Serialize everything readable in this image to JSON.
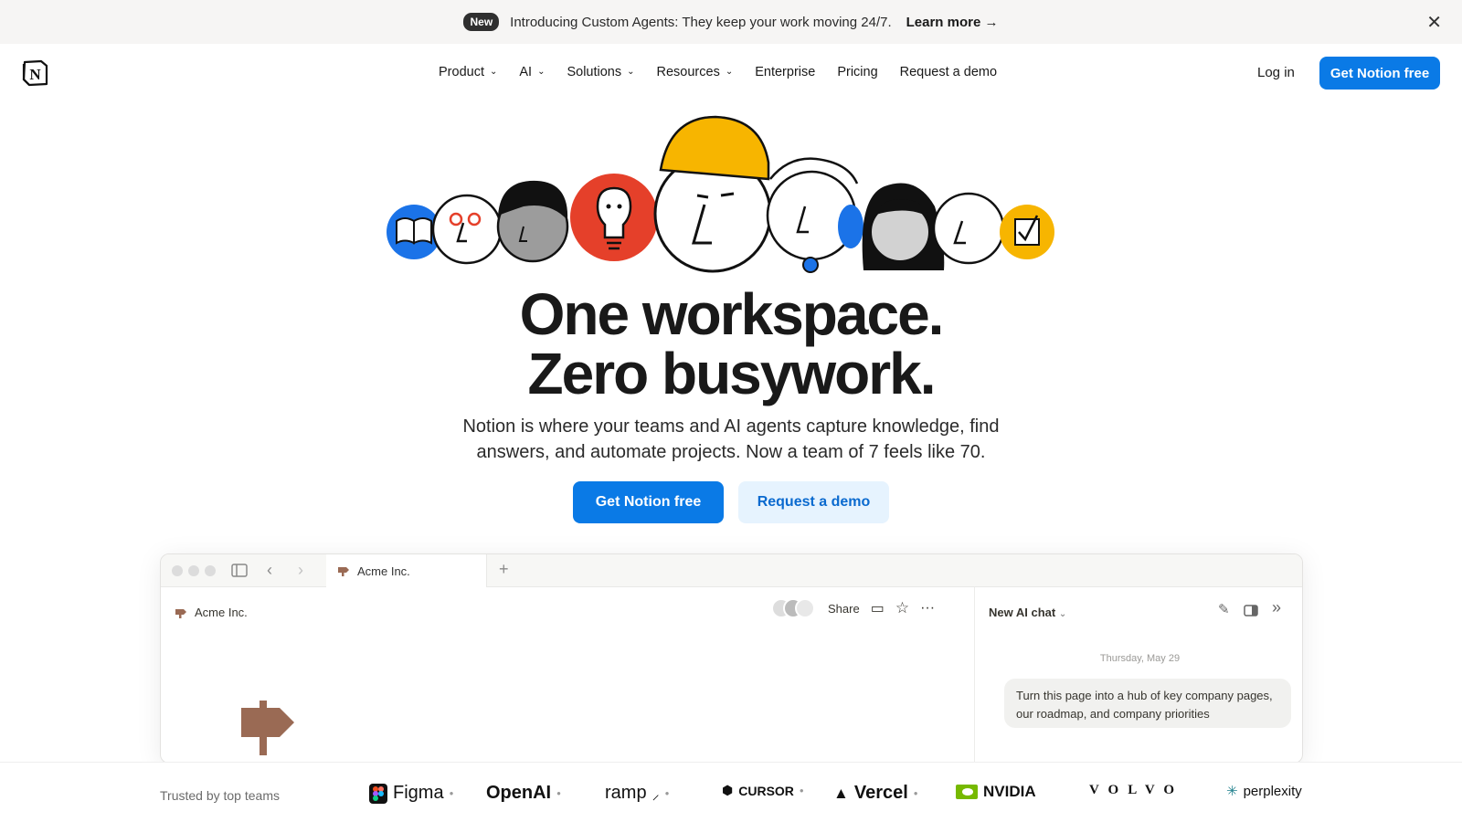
{
  "banner": {
    "badge": "New",
    "text": "Introducing Custom Agents: They keep your work moving 24/7.",
    "link": "Learn more →",
    "close": "✕"
  },
  "nav": {
    "items": [
      {
        "label": "Product",
        "dropdown": true
      },
      {
        "label": "AI",
        "dropdown": true
      },
      {
        "label": "Solutions",
        "dropdown": true
      },
      {
        "label": "Resources",
        "dropdown": true
      },
      {
        "label": "Enterprise",
        "dropdown": false
      },
      {
        "label": "Pricing",
        "dropdown": false
      },
      {
        "label": "Request a demo",
        "dropdown": false
      }
    ],
    "login": "Log in",
    "cta": "Get Notion free"
  },
  "hero": {
    "headline_1": "One workspace.",
    "headline_2": "Zero busywork.",
    "sub_1": "Notion is where your teams and AI agents capture knowledge, find",
    "sub_2": "answers, and automate projects. Now a team of 7 feels like 70.",
    "cta_primary": "Get Notion free",
    "cta_secondary": "Request a demo"
  },
  "app": {
    "tab_title": "Acme Inc.",
    "breadcrumb": "Acme Inc.",
    "share": "Share",
    "chat_title": "New AI chat",
    "chat_date": "Thursday, May 29",
    "chat_message": "Turn this page into a hub of key company pages, our roadmap, and company priorities"
  },
  "logos": {
    "trusted": "Trusted by top teams",
    "brands": [
      "Figma",
      "OpenAI",
      "ramp",
      "CURSOR",
      "Vercel",
      "NVIDIA",
      "VOLVO",
      "perplexity"
    ]
  },
  "colors": {
    "accent": "#0a7ae6",
    "accent_light": "#e6f3fe",
    "banner_bg": "#f6f5f4",
    "signpost": "#9a6a54"
  }
}
